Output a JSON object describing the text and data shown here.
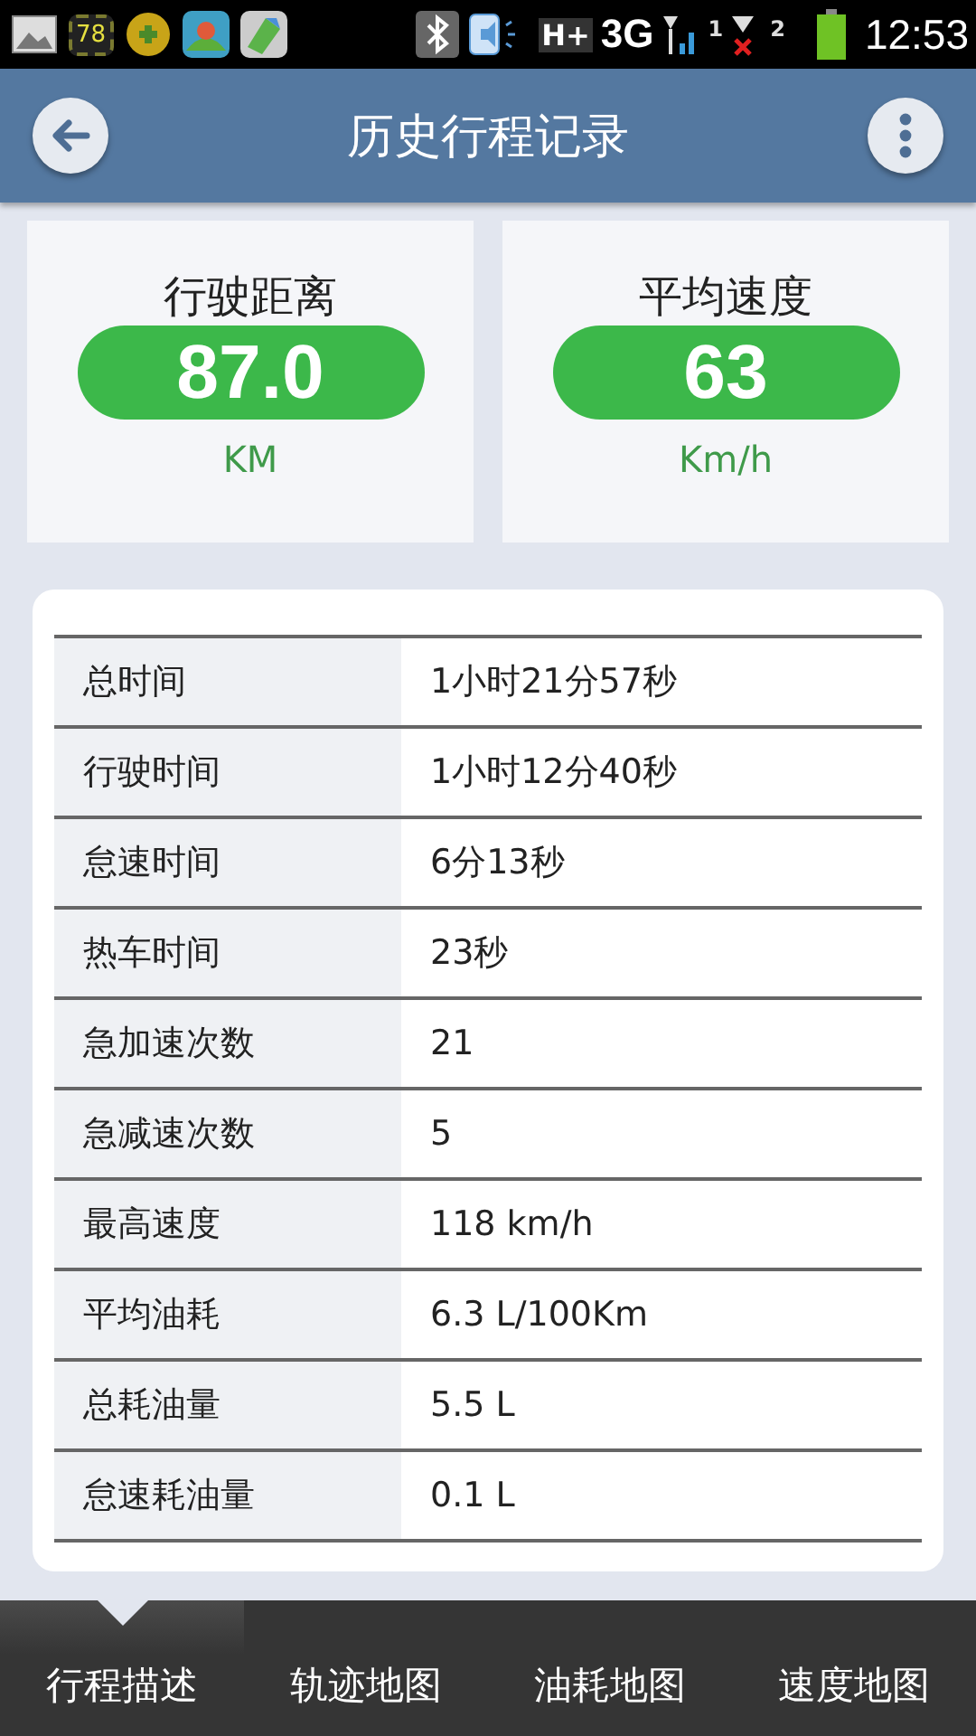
{
  "status_bar": {
    "notification_badge": "78",
    "network": "H+",
    "signal_type": "3G",
    "sim_1": "1",
    "sim_2": "2",
    "time": "12:53"
  },
  "header": {
    "title": "历史行程记录"
  },
  "summary": [
    {
      "label": "行驶距离",
      "value": "87.0",
      "unit": "KM"
    },
    {
      "label": "平均速度",
      "value": "63",
      "unit": "Km/h"
    }
  ],
  "details": [
    {
      "label": "总时间",
      "value": "1小时21分57秒"
    },
    {
      "label": "行驶时间",
      "value": "1小时12分40秒"
    },
    {
      "label": "怠速时间",
      "value": "6分13秒"
    },
    {
      "label": "热车时间",
      "value": "23秒"
    },
    {
      "label": "急加速次数",
      "value": "21"
    },
    {
      "label": "急减速次数",
      "value": "5"
    },
    {
      "label": "最高速度",
      "value": "118 km/h"
    },
    {
      "label": "平均油耗",
      "value": "6.3 L/100Km"
    },
    {
      "label": "总耗油量",
      "value": "5.5 L"
    },
    {
      "label": "怠速耗油量",
      "value": "0.1 L"
    }
  ],
  "tabs": [
    {
      "label": "行程描述",
      "selected": true
    },
    {
      "label": "轨迹地图",
      "selected": false
    },
    {
      "label": "油耗地图",
      "selected": false
    },
    {
      "label": "速度地图",
      "selected": false
    }
  ]
}
